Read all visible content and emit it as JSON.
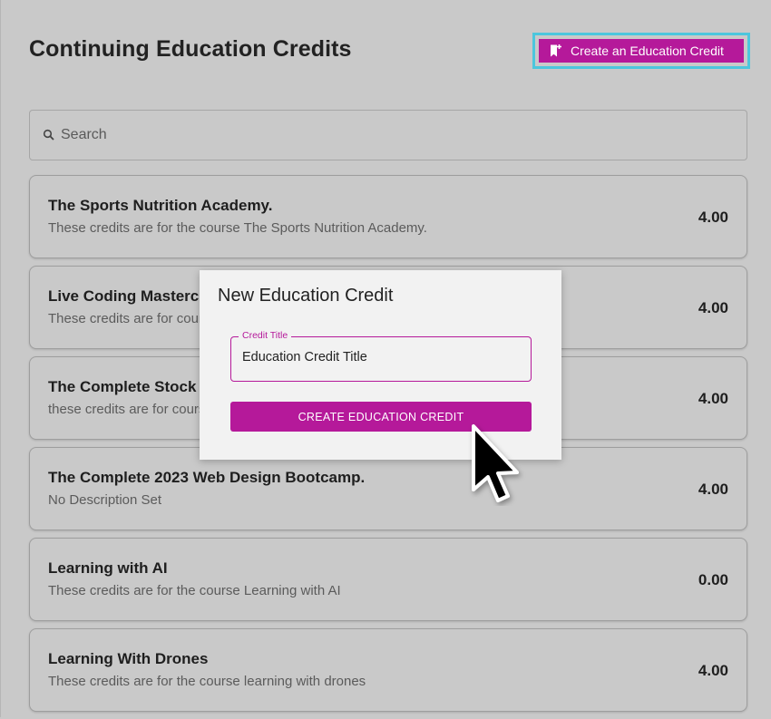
{
  "header": {
    "title": "Continuing Education Credits",
    "create_button_label": "Create an Education Credit",
    "create_button_icon": "bookmark-add-icon"
  },
  "search": {
    "placeholder": "Search",
    "icon": "search-icon"
  },
  "credits": [
    {
      "title": "The Sports Nutrition Academy.",
      "description": "These credits are for the course The Sports Nutrition Academy.",
      "value": "4.00"
    },
    {
      "title": "Live Coding Masterclass",
      "description": "These credits are for course",
      "value": "4.00"
    },
    {
      "title": "The Complete Stock",
      "description": "these credits are for course",
      "value": "4.00"
    },
    {
      "title": "The Complete 2023 Web Design Bootcamp.",
      "description": "No Description Set",
      "value": "4.00"
    },
    {
      "title": "Learning with AI",
      "description": "These credits are for the course Learning with AI",
      "value": "0.00"
    },
    {
      "title": "Learning With Drones",
      "description": "These credits are for the course learning with drones",
      "value": "4.00"
    }
  ],
  "modal": {
    "title": "New Education Credit",
    "field_label": "Credit Title",
    "field_value": "Education Credit Title",
    "submit_label": "CREATE EDUCATION CREDIT"
  },
  "colors": {
    "accent": "#b5199a",
    "focus_ring": "#4cc6dd",
    "overlay_background": "#c9c9c9",
    "modal_background": "#f2f2f2"
  },
  "cursor": {
    "icon": "mouse-pointer-icon"
  }
}
